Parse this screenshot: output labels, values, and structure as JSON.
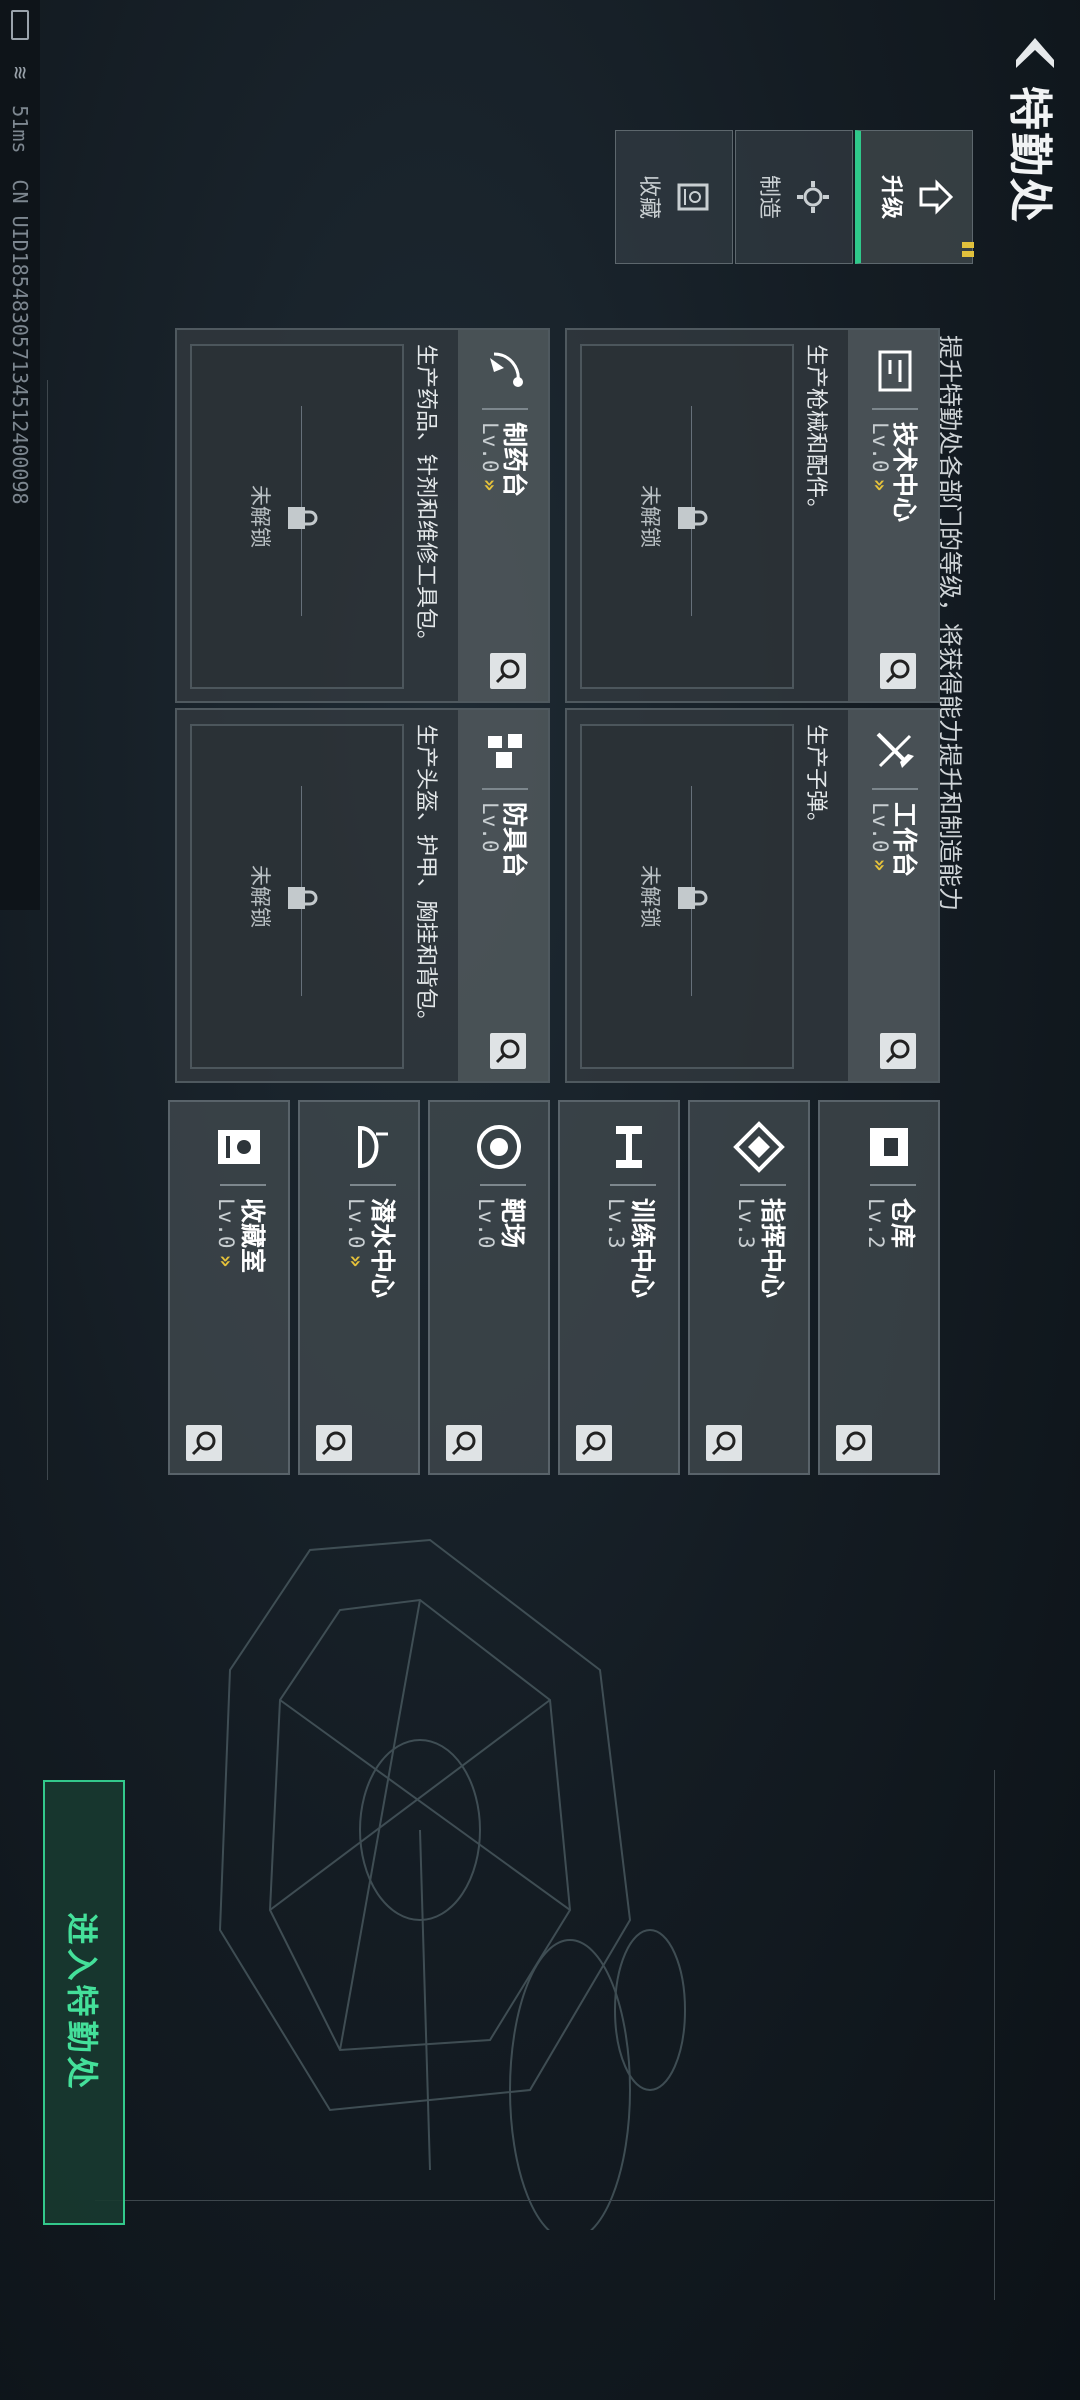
{
  "header": {
    "title": "特勤处",
    "subtitle": "提升特勤处各部门的等级，将获得能力提升和制造能力"
  },
  "tabs": [
    {
      "label": "升级",
      "icon": "upgrade-icon",
      "active": true
    },
    {
      "label": "制造",
      "icon": "gear-icon",
      "active": false
    },
    {
      "label": "收藏",
      "icon": "collection-icon",
      "active": false
    }
  ],
  "big_cards": [
    {
      "name": "技术中心",
      "level": "Lv.0",
      "desc": "生产枪械和配件。",
      "locked_text": "未解锁",
      "icon": "tech-center-icon",
      "upgradable": true
    },
    {
      "name": "工作台",
      "level": "Lv.0",
      "desc": "生产子弹。",
      "locked_text": "未解锁",
      "icon": "workbench-icon",
      "upgradable": true
    },
    {
      "name": "制药台",
      "level": "Lv.0",
      "desc": "生产药品、针剂和维修工具包。",
      "locked_text": "未解锁",
      "icon": "pharmacy-icon",
      "upgradable": true
    },
    {
      "name": "防具台",
      "level": "Lv.0",
      "desc": "生产头盔、护甲、胸挂和背包。",
      "locked_text": "未解锁",
      "icon": "armor-bench-icon",
      "upgradable": false
    }
  ],
  "small_cards": [
    {
      "name": "仓库",
      "level": "Lv.2",
      "icon": "warehouse-icon",
      "upgradable": false
    },
    {
      "name": "指挥中心",
      "level": "Lv.3",
      "icon": "command-center-icon",
      "upgradable": false
    },
    {
      "name": "训练中心",
      "level": "Lv.3",
      "icon": "training-icon",
      "upgradable": false
    },
    {
      "name": "靶场",
      "level": "Lv.0",
      "icon": "shooting-range-icon",
      "upgradable": false
    },
    {
      "name": "潜水中心",
      "level": "Lv.0",
      "icon": "diving-center-icon",
      "upgradable": true
    },
    {
      "name": "收藏室",
      "level": "Lv.0",
      "icon": "collection-room-icon",
      "upgradable": true
    }
  ],
  "enter_button": "进入特勤处",
  "status": {
    "ping": "51ms",
    "uid": "CN UID185483057134512400098"
  },
  "colors": {
    "accent_green": "#2fc88a",
    "upgrade_chevron": "#e6c23a"
  }
}
